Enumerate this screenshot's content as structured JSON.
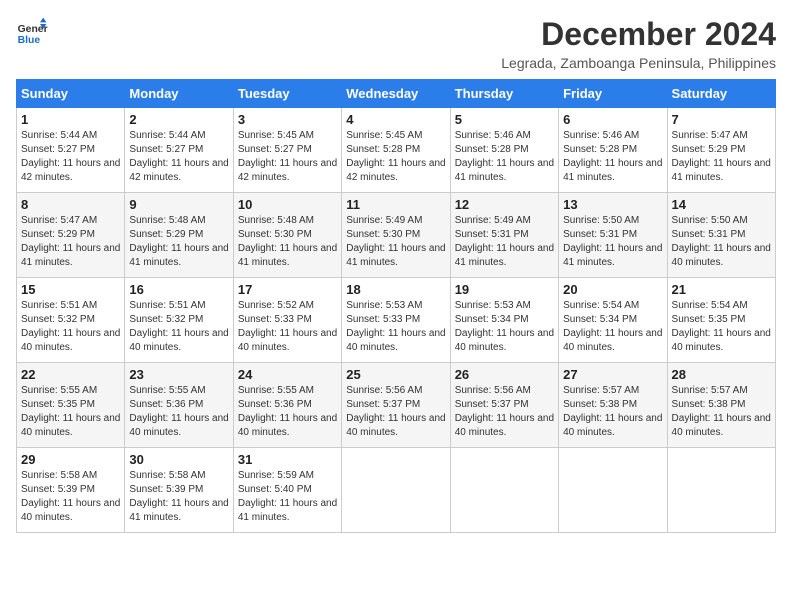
{
  "logo": {
    "line1": "General",
    "line2": "Blue"
  },
  "title": "December 2024",
  "subtitle": "Legrada, Zamboanga Peninsula, Philippines",
  "weekdays": [
    "Sunday",
    "Monday",
    "Tuesday",
    "Wednesday",
    "Thursday",
    "Friday",
    "Saturday"
  ],
  "weeks": [
    [
      {
        "day": "1",
        "sunrise": "5:44 AM",
        "sunset": "5:27 PM",
        "daylight": "11 hours and 42 minutes."
      },
      {
        "day": "2",
        "sunrise": "5:44 AM",
        "sunset": "5:27 PM",
        "daylight": "11 hours and 42 minutes."
      },
      {
        "day": "3",
        "sunrise": "5:45 AM",
        "sunset": "5:27 PM",
        "daylight": "11 hours and 42 minutes."
      },
      {
        "day": "4",
        "sunrise": "5:45 AM",
        "sunset": "5:28 PM",
        "daylight": "11 hours and 42 minutes."
      },
      {
        "day": "5",
        "sunrise": "5:46 AM",
        "sunset": "5:28 PM",
        "daylight": "11 hours and 41 minutes."
      },
      {
        "day": "6",
        "sunrise": "5:46 AM",
        "sunset": "5:28 PM",
        "daylight": "11 hours and 41 minutes."
      },
      {
        "day": "7",
        "sunrise": "5:47 AM",
        "sunset": "5:29 PM",
        "daylight": "11 hours and 41 minutes."
      }
    ],
    [
      {
        "day": "8",
        "sunrise": "5:47 AM",
        "sunset": "5:29 PM",
        "daylight": "11 hours and 41 minutes."
      },
      {
        "day": "9",
        "sunrise": "5:48 AM",
        "sunset": "5:29 PM",
        "daylight": "11 hours and 41 minutes."
      },
      {
        "day": "10",
        "sunrise": "5:48 AM",
        "sunset": "5:30 PM",
        "daylight": "11 hours and 41 minutes."
      },
      {
        "day": "11",
        "sunrise": "5:49 AM",
        "sunset": "5:30 PM",
        "daylight": "11 hours and 41 minutes."
      },
      {
        "day": "12",
        "sunrise": "5:49 AM",
        "sunset": "5:31 PM",
        "daylight": "11 hours and 41 minutes."
      },
      {
        "day": "13",
        "sunrise": "5:50 AM",
        "sunset": "5:31 PM",
        "daylight": "11 hours and 41 minutes."
      },
      {
        "day": "14",
        "sunrise": "5:50 AM",
        "sunset": "5:31 PM",
        "daylight": "11 hours and 40 minutes."
      }
    ],
    [
      {
        "day": "15",
        "sunrise": "5:51 AM",
        "sunset": "5:32 PM",
        "daylight": "11 hours and 40 minutes."
      },
      {
        "day": "16",
        "sunrise": "5:51 AM",
        "sunset": "5:32 PM",
        "daylight": "11 hours and 40 minutes."
      },
      {
        "day": "17",
        "sunrise": "5:52 AM",
        "sunset": "5:33 PM",
        "daylight": "11 hours and 40 minutes."
      },
      {
        "day": "18",
        "sunrise": "5:53 AM",
        "sunset": "5:33 PM",
        "daylight": "11 hours and 40 minutes."
      },
      {
        "day": "19",
        "sunrise": "5:53 AM",
        "sunset": "5:34 PM",
        "daylight": "11 hours and 40 minutes."
      },
      {
        "day": "20",
        "sunrise": "5:54 AM",
        "sunset": "5:34 PM",
        "daylight": "11 hours and 40 minutes."
      },
      {
        "day": "21",
        "sunrise": "5:54 AM",
        "sunset": "5:35 PM",
        "daylight": "11 hours and 40 minutes."
      }
    ],
    [
      {
        "day": "22",
        "sunrise": "5:55 AM",
        "sunset": "5:35 PM",
        "daylight": "11 hours and 40 minutes."
      },
      {
        "day": "23",
        "sunrise": "5:55 AM",
        "sunset": "5:36 PM",
        "daylight": "11 hours and 40 minutes."
      },
      {
        "day": "24",
        "sunrise": "5:55 AM",
        "sunset": "5:36 PM",
        "daylight": "11 hours and 40 minutes."
      },
      {
        "day": "25",
        "sunrise": "5:56 AM",
        "sunset": "5:37 PM",
        "daylight": "11 hours and 40 minutes."
      },
      {
        "day": "26",
        "sunrise": "5:56 AM",
        "sunset": "5:37 PM",
        "daylight": "11 hours and 40 minutes."
      },
      {
        "day": "27",
        "sunrise": "5:57 AM",
        "sunset": "5:38 PM",
        "daylight": "11 hours and 40 minutes."
      },
      {
        "day": "28",
        "sunrise": "5:57 AM",
        "sunset": "5:38 PM",
        "daylight": "11 hours and 40 minutes."
      }
    ],
    [
      {
        "day": "29",
        "sunrise": "5:58 AM",
        "sunset": "5:39 PM",
        "daylight": "11 hours and 40 minutes."
      },
      {
        "day": "30",
        "sunrise": "5:58 AM",
        "sunset": "5:39 PM",
        "daylight": "11 hours and 41 minutes."
      },
      {
        "day": "31",
        "sunrise": "5:59 AM",
        "sunset": "5:40 PM",
        "daylight": "11 hours and 41 minutes."
      },
      null,
      null,
      null,
      null
    ]
  ],
  "labels": {
    "sunrise": "Sunrise:",
    "sunset": "Sunset:",
    "daylight": "Daylight:"
  }
}
